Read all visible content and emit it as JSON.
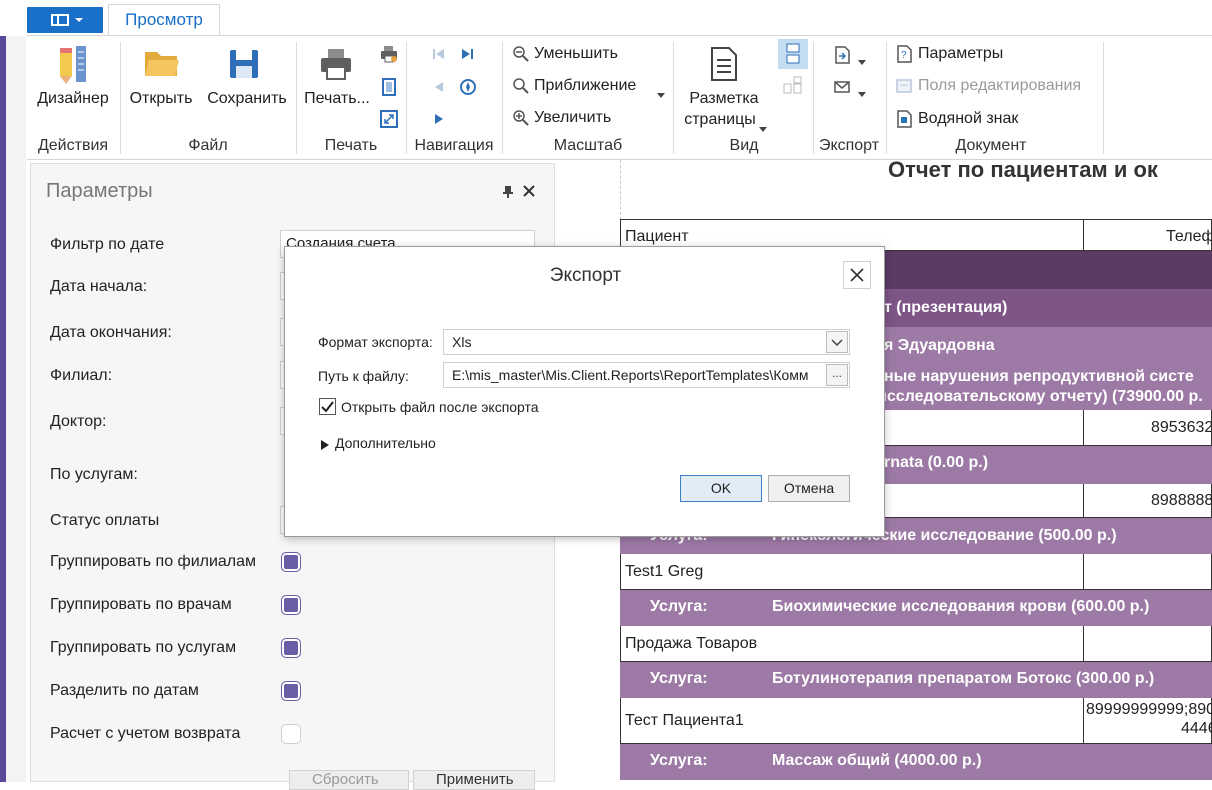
{
  "ribbon": {
    "tab_view": "Просмотр",
    "groups": {
      "actions": {
        "label": "Действия",
        "designer": "Дизайнер"
      },
      "file": {
        "label": "Файл",
        "open": "Открыть",
        "save": "Сохранить"
      },
      "print": {
        "label": "Печать",
        "print": "Печать..."
      },
      "navigation": {
        "label": "Навигация"
      },
      "zoom": {
        "label": "Масштаб",
        "zoom_out": "Уменьшить",
        "zoom": "Приближение",
        "zoom_in": "Увеличить"
      },
      "view": {
        "label": "Вид",
        "layout_line1": "Разметка",
        "layout_line2": "страницы"
      },
      "export": {
        "label": "Экспорт"
      },
      "document": {
        "label": "Документ",
        "parameters": "Параметры",
        "edit_fields": "Поля редактирования",
        "watermark": "Водяной знак"
      }
    }
  },
  "params": {
    "title": "Параметры",
    "rows": {
      "date_filter": {
        "label": "Фильтр по дате",
        "value": "Создания счета"
      },
      "date_start": {
        "label": "Дата начала:"
      },
      "date_end": {
        "label": "Дата окончания:"
      },
      "branch": {
        "label": "Филиал:"
      },
      "doctor": {
        "label": "Доктор:"
      },
      "by_services": {
        "label": "По услугам:"
      },
      "pay_status": {
        "label": "Статус оплаты"
      },
      "group_branches": {
        "label": "Группировать по филиалам",
        "checked": true
      },
      "group_doctors": {
        "label": "Группировать по врачам",
        "checked": true
      },
      "group_services": {
        "label": "Группировать по услугам",
        "checked": true
      },
      "split_dates": {
        "label": "Разделить по датам",
        "checked": true
      },
      "with_refund": {
        "label": "Расчет с учетом возврата",
        "checked": false
      }
    },
    "buttons": {
      "reset": "Сбросить",
      "submit": "Применить"
    }
  },
  "report": {
    "title": "Отчет по пациентам и ок",
    "header": {
      "patient": "Пациент",
      "phone": "Телеф"
    },
    "rows": {
      "r1": "т (презентация)",
      "r2": "я Эдуардовна",
      "r3_line1": "ные нарушения репродуктивной систе",
      "r3_line2": "исследовательскому отчету) (73900.00 р.",
      "r4_phone": "8953632",
      "r5": "rnata (0.00 р.)",
      "r6_phone": "8988888",
      "r7_service": "Услуга:",
      "r7_text": "Гинекологические исследование (500.00 р.)",
      "r8_patient": "Test1 Greg",
      "r9_service": "Услуга:",
      "r9_text": "Биохимические исследования крови (600.00 р.)",
      "r10_patient": "Продажа  Товаров",
      "r11_service": "Услуга:",
      "r11_text": "Ботулинотерапия препаратом Ботокс (300.00 р.)",
      "r12_patient": "Тест Пациента1",
      "r12_phone_line1": "89999999999;890",
      "r12_phone_line2": "4446",
      "r13_service": "Услуга:",
      "r13_text": "Массаж общий (4000.00 р.)"
    }
  },
  "dialog": {
    "title": "Экспорт",
    "format_label": "Формат экспорта:",
    "format_value": "Xls",
    "path_label": "Путь к файлу:",
    "path_value": "E:\\mis_master\\Mis.Client.Reports\\ReportTemplates\\Комм",
    "path_btn": "...",
    "open_after_label": "Открыть файл после экспорта",
    "open_after_checked": true,
    "more_label": "Дополнительно",
    "ok": "OK",
    "cancel": "Отмена"
  },
  "colors": {
    "accent": "#1a6fc9",
    "check": "#6a5ea5",
    "purple_dark": "#5b3a63",
    "purple_mid": "#7d5586",
    "purple_light": "#9d7aa6"
  }
}
